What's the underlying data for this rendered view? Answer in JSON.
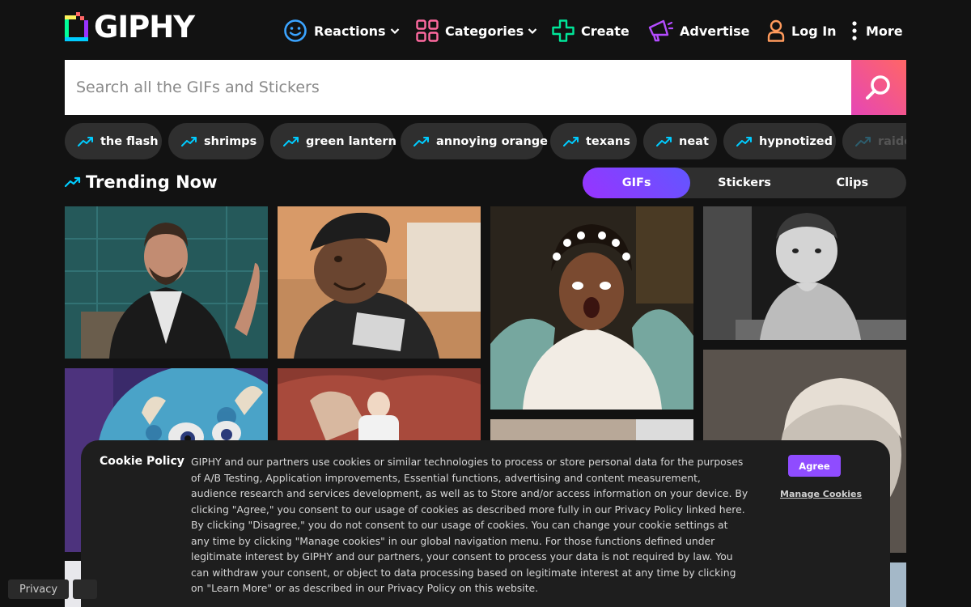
{
  "brand": {
    "name": "GIPHY"
  },
  "nav": {
    "reactions": "Reactions",
    "categories": "Categories",
    "create": "Create",
    "advertise": "Advertise",
    "login": "Log In",
    "more": "More"
  },
  "search": {
    "placeholder": "Search all the GIFs and Stickers",
    "value": ""
  },
  "trending_searches": [
    "the flash",
    "shrimps",
    "green lantern",
    "annoying orange",
    "texans",
    "neat",
    "hypnotized",
    "raiders"
  ],
  "trending": {
    "title": "Trending Now",
    "tabs": [
      "GIFs",
      "Stickers",
      "Clips"
    ],
    "active_tab": "GIFs"
  },
  "cookie": {
    "title": "Cookie Policy",
    "text": "GIPHY and our partners use cookies or similar technologies to process or store personal data for the purposes of A/B Testing, Application improvements, Essential functions, advertising and content measurement, audience research and services development, as well as to Store and/or access information on your device. By clicking \"Agree,\" you consent to our usage of cookies as described more fully in our Privacy Policy linked here. By clicking \"Disagree,\" you do not consent to our usage of cookies. You can change your cookie settings at any time by clicking \"Manage cookies\" in our global navigation menu. For those functions defined under legitimate interest by GIPHY and our partners, your consent to process your data is not required by law. You can withdraw your consent, or object to data processing based on legitimate interest at any time by clicking on \"Learn More\" or as described in our Privacy Policy on this website.",
    "agree": "Agree",
    "manage": "Manage Cookies"
  },
  "footer": {
    "privacy": "Privacy"
  },
  "colors": {
    "background": "#121212",
    "pill": "#2f2f2f",
    "accent_purple": "#9933ff",
    "accent_pink": "#e646b6",
    "trend_cyan": "#00ccff"
  },
  "icons": {
    "reactions": "smiley-icon",
    "categories": "grid-icon",
    "create": "plus-icon",
    "advertise": "megaphone-icon",
    "login": "user-icon",
    "more": "vertical-dots-icon",
    "search": "search-icon",
    "trending": "trend-arrow-icon"
  }
}
